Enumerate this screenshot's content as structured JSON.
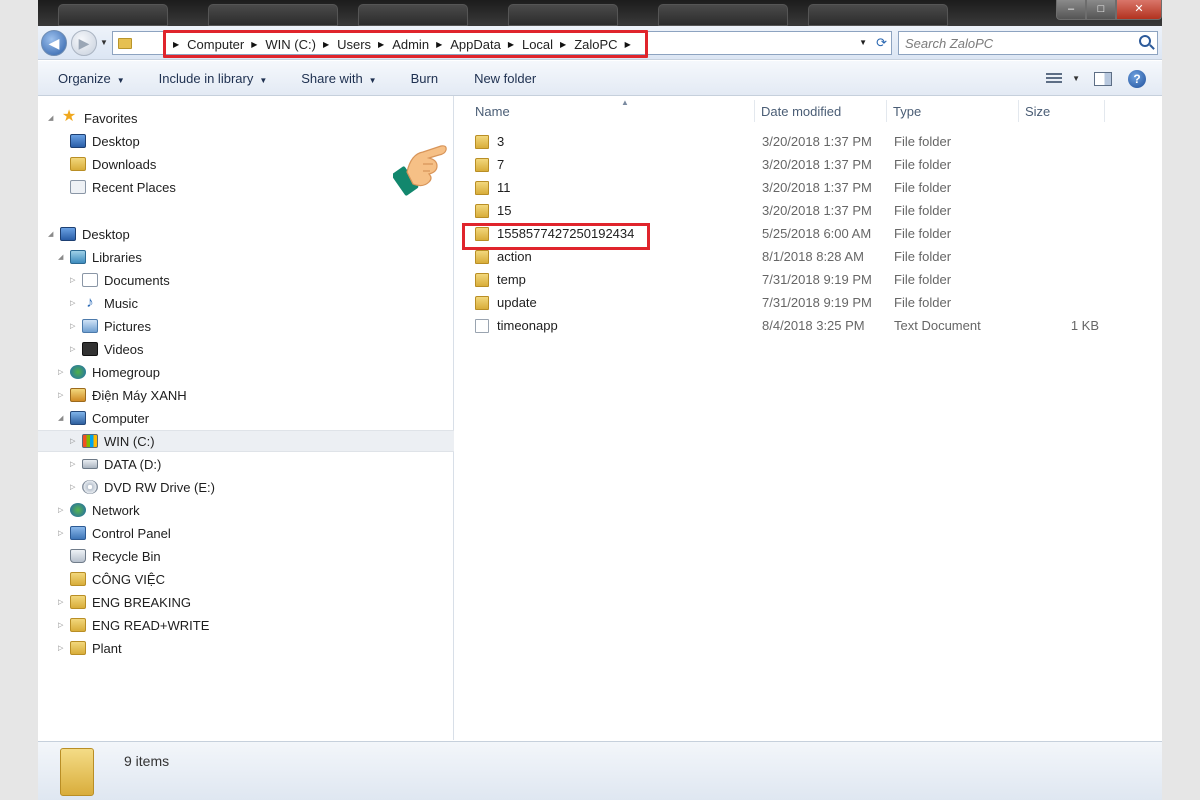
{
  "titlebar": {
    "min": "‒",
    "max": "□",
    "close": "✕"
  },
  "nav": {
    "breadcrumbs": [
      "Computer",
      "WIN (C:)",
      "Users",
      "Admin",
      "AppData",
      "Local",
      "ZaloPC"
    ],
    "search_placeholder": "Search ZaloPC"
  },
  "toolbar": {
    "organize": "Organize",
    "include_library": "Include in library",
    "share_with": "Share with",
    "burn": "Burn",
    "new_folder": "New folder"
  },
  "sidebar": {
    "favorites": "Favorites",
    "fav_items": [
      "Desktop",
      "Downloads",
      "Recent Places"
    ],
    "desktop": "Desktop",
    "libraries": "Libraries",
    "lib_items": [
      "Documents",
      "Music",
      "Pictures",
      "Videos"
    ],
    "homegroup": "Homegroup",
    "dien_may_xanh": "Điện Máy XANH",
    "computer": "Computer",
    "drives": [
      "WIN (C:)",
      "DATA (D:)",
      "DVD RW Drive (E:)"
    ],
    "network": "Network",
    "control_panel": "Control Panel",
    "recycle_bin": "Recycle Bin",
    "folders": [
      "CÔNG VIỆC",
      "ENG BREAKING",
      "ENG READ+WRITE",
      "Plant"
    ]
  },
  "columns": {
    "name": "Name",
    "date": "Date modified",
    "type": "Type",
    "size": "Size"
  },
  "files": [
    {
      "name": "3",
      "date": "3/20/2018 1:37 PM",
      "type": "File folder",
      "size": ""
    },
    {
      "name": "7",
      "date": "3/20/2018 1:37 PM",
      "type": "File folder",
      "size": ""
    },
    {
      "name": "11",
      "date": "3/20/2018 1:37 PM",
      "type": "File folder",
      "size": ""
    },
    {
      "name": "15",
      "date": "3/20/2018 1:37 PM",
      "type": "File folder",
      "size": ""
    },
    {
      "name": "1558577427250192434",
      "date": "5/25/2018 6:00 AM",
      "type": "File folder",
      "size": ""
    },
    {
      "name": "action",
      "date": "8/1/2018 8:28 AM",
      "type": "File folder",
      "size": ""
    },
    {
      "name": "temp",
      "date": "7/31/2018 9:19 PM",
      "type": "File folder",
      "size": ""
    },
    {
      "name": "update",
      "date": "7/31/2018 9:19 PM",
      "type": "File folder",
      "size": ""
    },
    {
      "name": "timeonapp",
      "date": "8/4/2018 3:25 PM",
      "type": "Text Document",
      "size": "1 KB"
    }
  ],
  "status": {
    "count": "9 items"
  },
  "colors": {
    "highlight_box": "#e0242c",
    "selected_row": "#eceff3"
  }
}
